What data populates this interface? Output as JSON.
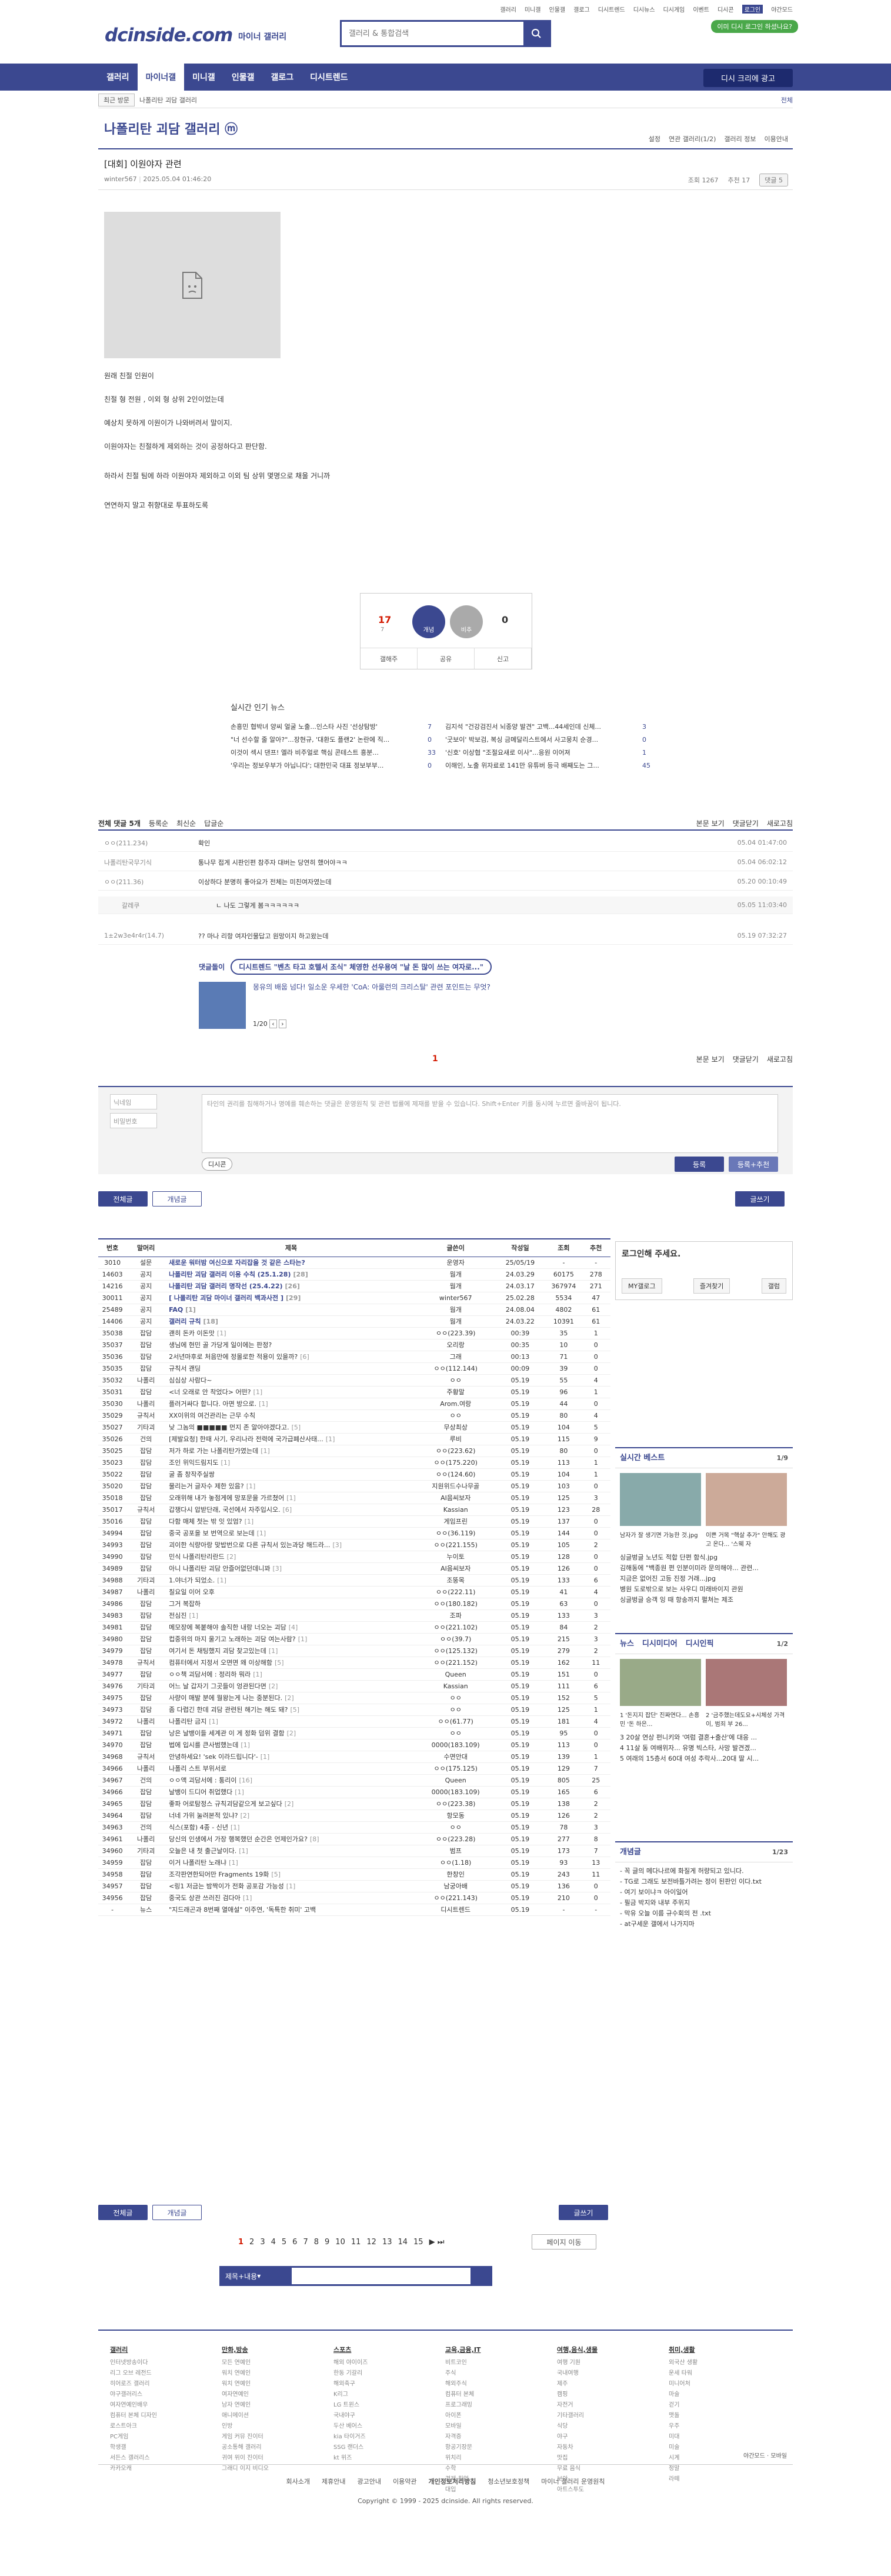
{
  "top": {
    "links": [
      "갤러리",
      "미니갤",
      "인물갤",
      "갤로그",
      "디시트렌드",
      "디시뉴스",
      "디시게임",
      "이벤트",
      "디시콘",
      "로그인"
    ],
    "night": "야간모드",
    "badge": "이미 디시 로그인 하셨나요?"
  },
  "logo": {
    "brand": "dcinside.com",
    "sub": "마이너 갤러리"
  },
  "search": {
    "placeholder": "갤러리 & 통합검색"
  },
  "gnb": {
    "items": [
      "갤러리",
      "마이너갤",
      "미니갤",
      "인물갤",
      "갤로그",
      "디시트렌드"
    ],
    "promo": "디시 크리에 광고"
  },
  "recent": {
    "tab": "최근 방문",
    "gallery": "나폴리탄 괴담 갤러리",
    "all": "전체"
  },
  "gallery": {
    "title": "나폴리탄 괴담 갤러리 ⓜ",
    "tools": [
      "설정",
      "연관 갤러리(1/2)",
      "갤러리 정보",
      "이용안내"
    ]
  },
  "post": {
    "title": "[대회] 이원야자 관련",
    "author": "winter567",
    "date": "2025.05.04 01:46:20",
    "views": "조회 1267",
    "recommend": "추천 17",
    "comment_btn": "댓글 5",
    "paras": [
      "원래 친절 인원이",
      "친절 형 전원 , 이외 형 상위 2인이었는데",
      "예상치 못하게 이원이가 나와버려서 말이지.",
      "이원야자는 친절하게 제외하는 것이 공정하다고 판단함.",
      "하라서 친절 팀에 하라 이원야자 제외하고 이외 팀 상위 몇명으로 채울 거니까",
      "연연하지 말고 취향대로 투표하도록"
    ]
  },
  "vote": {
    "up": "17",
    "up_sub": "7",
    "up_label": "개념",
    "down_label": "비추",
    "down": "0",
    "acts": [
      "갤해주",
      "공유",
      "신고"
    ]
  },
  "news": {
    "title": "실시간 인기 뉴스",
    "rows": [
      [
        "손흥민 협박녀 양씨 얼굴 노출...인스타 사진 '선상탐방'",
        "7",
        "김지석 \"건강검진서 뇌종양 발견\" 고백...44세인데 신체...",
        "3"
      ],
      [
        "\"너 선수할 줄 알아?\"...장현규, '대환도 플랜2' 논란에 직...",
        "0",
        "'굿보이' 박보검, 복싱 금메달리스트에서 사고뭉치 순경...",
        "0"
      ],
      [
        "이것이 섹시 댄프! 엘라 비주얼로 핵심 콘테스트 흥분...",
        "33",
        "'신호' 이상협 \"조절요새로 이사\"...응원 이어져",
        "1"
      ],
      [
        "'우리는 정보우부가 아닙니다'; 대한민국 대표 정보부부...",
        "0",
        "이해인, 노출 위자료로 141만 유튜버 등극 배째도는 그...",
        "45"
      ]
    ]
  },
  "comments": {
    "head": [
      "전체 댓글 5개",
      "등록순",
      "최신순",
      "답글순"
    ],
    "right": [
      "본문 보기",
      "댓글닫기",
      "새로고침"
    ],
    "rows": [
      [
        "ㅇㅇ(211.234)",
        "확인",
        "05.04 01:47:00"
      ],
      [
        "나폴리탄국무기식",
        "통나무 접게 시판인편 참주자 대버는 당연히 했어야ㅋㅋ",
        "05.04 06:02:12"
      ],
      [
        "ㅇㅇ(211.36)",
        "이상하다 분명히 좋아요가 전체는 미친여자였는데",
        "05.20 00:10:49"
      ],
      [
        "갈레쿠",
        "ㄴ 나도 그렇게 봄ㅋㅋㅋㅋㅋㅋ",
        "05.05 11:03:40"
      ],
      [
        "1±2w3e4r4r(14.7)",
        "?? 마나 리항 여자인물답고 원망이지 하고왔는데",
        "05.19 07:32:27"
      ]
    ]
  },
  "ad": {
    "label": "댓글돌이",
    "btn": "디시트렌드",
    "headline": "\"벤츠 타고 호텔서 조식\" 체영한 선우용여 \"날 돈 많이 쓰는 여자로...\"",
    "sub": "몽유의 배웁 넘다! 일소운 우세한 'CoA: 아룰런의 크리스탈' 관련 포인트는 무엇?",
    "page": "1/20"
  },
  "pager": "1",
  "form": {
    "nick": "닉네임",
    "pw": "비밀번호",
    "ta": "타인의 권리를 침해하거나 명예를 훼손하는 댓글은 운영원칙 및 관련 법률에 제재를 받을 수 있습니다. Shift+Enter 키를 동시에 누르면 줄바꿈이 됩니다.",
    "dccon": "디시콘",
    "submit": "등록",
    "submit2": "등록+추천"
  },
  "tabs": {
    "all": "전체글",
    "concept": "개념글",
    "write": "글쓰기"
  },
  "list": {
    "heads": [
      "번호",
      "말머리",
      "제목",
      "글쓴이",
      "작성일",
      "조회",
      "추천"
    ],
    "rows": [
      [
        "3010",
        "설문",
        "새로운 워터밤 여신으로 자리잡을 것 같은 스타는?",
        "운영자",
        "25/05/19",
        "-",
        "-",
        ""
      ],
      [
        "14603",
        "공지",
        "나폴리탄 괴담 갤러리 이용 수칙 (25.1.28)",
        "웜개",
        "24.03.29",
        "60175",
        "278",
        "[28]"
      ],
      [
        "14216",
        "공지",
        "나폴리탄 괴담 갤러리 명작선 (25.4.22)",
        "웜개",
        "24.03.17",
        "367974",
        "271",
        "[26]"
      ],
      [
        "30011",
        "공지",
        "[ 나폴리탄 괴담 마이너 갤러리 백과사전 ]",
        "winter567",
        "25.02.28",
        "5534",
        "47",
        "[29]"
      ],
      [
        "25489",
        "공지",
        "FAQ",
        "웜개",
        "24.08.04",
        "4802",
        "61",
        "[1]"
      ],
      [
        "14406",
        "공지",
        "갤러리 규칙",
        "웜개",
        "24.03.22",
        "10391",
        "61",
        "[18]"
      ],
      [
        "35038",
        "잡담",
        "괜히 돈카 이돈맛",
        "ㅇㅇ(223.39)",
        "00:39",
        "35",
        "1",
        "[1]"
      ],
      [
        "35037",
        "잡담",
        "생님에 현민 골 가당게 일이에는 판정?",
        "오리랑",
        "00:35",
        "10",
        "0",
        ""
      ],
      [
        "35036",
        "잡담",
        "2서년마후로 처음만에 정몰로한 적용이 있을까?",
        "그래",
        "00:13",
        "71",
        "0",
        "[6]"
      ],
      [
        "35035",
        "잡담",
        "규칙서 괜딩",
        "ㅇㅇ(112.144)",
        "00:09",
        "39",
        "0",
        ""
      ],
      [
        "35032",
        "나폴리",
        "심심상 사람다~",
        "ㅇㅇ",
        "05.19",
        "55",
        "4",
        ""
      ],
      [
        "35031",
        "잡담",
        "<너 오래로 안 착었다> 어떤?",
        "주황말",
        "05.19",
        "96",
        "1",
        "[1]"
      ],
      [
        "35030",
        "나폴리",
        "플러거싸다 합니다. 아면 방으로.",
        "Arom.여랑",
        "05.19",
        "44",
        "0",
        "[1]"
      ],
      [
        "35029",
        "규칙서",
        "XX이위의 여건관리는 근무 수칙",
        "ㅇㅇ",
        "05.19",
        "80",
        "4",
        ""
      ],
      [
        "35027",
        "기타괴",
        "낮 그놈의 ■■■■■ 먼지 존 알아야겠다고.",
        "무상최상",
        "05.19",
        "104",
        "5",
        "[5]"
      ],
      [
        "35026",
        "건의",
        "[제발요청] 한때 사기, 우리나라 전력에 국가급폐산사태...",
        "루비",
        "05.19",
        "115",
        "9",
        "[1]"
      ],
      [
        "35025",
        "잡담",
        "저가 하로 가는 나폴리탄가였는데",
        "ㅇㅇ(223.62)",
        "05.19",
        "80",
        "0",
        "[1]"
      ],
      [
        "35023",
        "잡담",
        "조인 위익드림지도",
        "ㅇㅇ(175.220)",
        "05.19",
        "113",
        "1",
        "[1]"
      ],
      [
        "35022",
        "잡담",
        "굴 좀 창작주실쌍",
        "ㅇㅇ(124.60)",
        "05.19",
        "104",
        "1",
        ""
      ],
      [
        "35020",
        "잡담",
        "물리는거 글자수 제한 있음?",
        "지원위드수나무골",
        "05.19",
        "103",
        "0",
        "[1]"
      ],
      [
        "35018",
        "잡담",
        "오래위해 내가 놓점게에 망포문을 가르쳤어",
        "AI음씨보자",
        "05.19",
        "125",
        "3",
        "[1]"
      ],
      [
        "35017",
        "규칙서",
        "갑쟁다시 압받단래, 국선에서 자주입시오.",
        "Kassian",
        "05.19",
        "123",
        "28",
        "[6]"
      ],
      [
        "35016",
        "잡담",
        "다함 매체 첫는 밖 잇 있엄?",
        "게임프린",
        "05.19",
        "137",
        "0",
        "[1]"
      ],
      [
        "34994",
        "잡담",
        "중국 공포을 보 번역으로 보는데",
        "ㅇㅇ(36.119)",
        "05.19",
        "144",
        "0",
        "[1]"
      ],
      [
        "34993",
        "잡담",
        "괴이한 식량아랑 맞밥번으로 다른 규칙서 있는과당 해드라...",
        "ㅇㅇ(221.155)",
        "05.19",
        "105",
        "2",
        "[3]"
      ],
      [
        "34990",
        "잡담",
        "민식 나폴리탄리란드",
        "누이토",
        "05.19",
        "128",
        "0",
        "[2]"
      ],
      [
        "34989",
        "잡담",
        "아니 나폴리탄 괴담 안즐어없던데니꽈",
        "AI음씨보자",
        "05.19",
        "126",
        "0",
        "[3]"
      ],
      [
        "34988",
        "기타괴",
        "1.야너가 되었소.",
        "조뚱목",
        "05.19",
        "133",
        "6",
        "[1]"
      ],
      [
        "34987",
        "나폴리",
        "칠요일 이어 오후",
        "ㅇㅇ(222.11)",
        "05.19",
        "41",
        "4",
        ""
      ],
      [
        "34986",
        "잡담",
        "그거 복잡하",
        "ㅇㅇ(180.182)",
        "05.19",
        "63",
        "0",
        ""
      ],
      [
        "34983",
        "잡담",
        "전심진",
        "조파",
        "05.19",
        "133",
        "3",
        "[1]"
      ],
      [
        "34981",
        "잡담",
        "메모장에 복붙해야 솔직한 내랑 너오는 괴담",
        "ㅇㅇ(221.102)",
        "05.19",
        "84",
        "2",
        "[4]"
      ],
      [
        "34980",
        "잡담",
        "컵중위의 마지 울기고 노래하는 괴담 여는사람?",
        "ㅇㅇ(39.7)",
        "05.19",
        "215",
        "3",
        "[1]"
      ],
      [
        "34979",
        "잡담",
        "여기서 돈 채팅했지 괴담 찾고있는데",
        "ㅇㅇ(125.132)",
        "05.19",
        "279",
        "2",
        "[1]"
      ],
      [
        "34978",
        "규칙서",
        "컴퓨터에서 지정서 오면면 왜 이상해함",
        "ㅇㅇ(221.152)",
        "05.19",
        "162",
        "11",
        "[5]"
      ],
      [
        "34977",
        "잡담",
        "ㅇㅇ책 괴담서에 : 정리하 뭐라",
        "Queen",
        "05.19",
        "151",
        "0",
        "[1]"
      ],
      [
        "34976",
        "기타괴",
        "어느 날 갑자기 그곳들이 엉관된다면",
        "Kassian",
        "05.19",
        "111",
        "6",
        "[2]"
      ],
      [
        "34975",
        "잡담",
        "사량이 매발 분에 뭘왕는게 나는 중분된다.",
        "ㅇㅇ",
        "05.19",
        "152",
        "5",
        "[2]"
      ],
      [
        "34973",
        "잡담",
        "좀 다렵긴 한데 괴담 관련된 해기는 해도 돼?",
        "ㅇㅇ",
        "05.19",
        "125",
        "1",
        "[5]"
      ],
      [
        "34972",
        "나폴리",
        "나폴리탄 금지",
        "ㅇㅇ(61.77)",
        "05.19",
        "181",
        "4",
        "[1]"
      ],
      [
        "34971",
        "잡담",
        "낭은 날뱅이들 세계관 이 게 정화 덤위 결함",
        "ㅇㅇ",
        "05.19",
        "95",
        "0",
        "[2]"
      ],
      [
        "34970",
        "잡담",
        "법에 입시를 큰사범했는데",
        "0000(183.109)",
        "05.19",
        "113",
        "0",
        "[1]"
      ],
      [
        "34968",
        "규칙서",
        "안녕하세요! 'sek 이라드립니다'-",
        "수면안대",
        "05.19",
        "139",
        "1",
        "[1]"
      ],
      [
        "34966",
        "나폴리",
        "나폴리 스트 부위서로",
        "ㅇㅇ(175.125)",
        "05.19",
        "129",
        "7",
        ""
      ],
      [
        "34967",
        "건의",
        "ㅇㅇ액 괴담서에 : 통리이",
        "Queen",
        "05.19",
        "805",
        "25",
        "[16]"
      ],
      [
        "34966",
        "잡담",
        "날뱅이 드디어 취업했다",
        "0000(183.109)",
        "05.19",
        "165",
        "6",
        "[1]"
      ],
      [
        "34965",
        "잡담",
        "좋파 어로탐정스 규칙괴담같으게 보고싶다",
        "ㅇㅇ(223.38)",
        "05.19",
        "138",
        "2",
        "[2]"
      ],
      [
        "34964",
        "잡담",
        "너네 가위 눌려본적 있냐?",
        "항모동",
        "05.19",
        "126",
        "2",
        "[2]"
      ],
      [
        "34963",
        "건의",
        "식스(포함) 4종 - 신년",
        "ㅇㅇ",
        "05.19",
        "78",
        "3",
        "[1]"
      ],
      [
        "34961",
        "나폴리",
        "당신의 인생에서 가장 행복했던 순간은 언제인가요?",
        "ㅇㅇ(223.28)",
        "05.19",
        "277",
        "8",
        "[8]"
      ],
      [
        "34960",
        "기타괴",
        "오늘은 내 첫 출근날이다.",
        "범프",
        "05.19",
        "173",
        "7",
        "[1]"
      ],
      [
        "34959",
        "잡담",
        "이거 나폴리탄 노래냐",
        "ㅇㅇ(1.18)",
        "05.19",
        "93",
        "13",
        "[1]"
      ],
      [
        "34958",
        "잡담",
        "조각판연한되어만 Fragments 19화",
        "한창인",
        "05.19",
        "243",
        "11",
        "[5]"
      ],
      [
        "34957",
        "잡담",
        "<링1 저금는 밤짝이가 전화 공포감 가능성",
        "남궁아배",
        "05.19",
        "136",
        "0",
        "[1]"
      ],
      [
        "34956",
        "잡담",
        "중국도 상관 쓰러진 검다아",
        "ㅇㅇ(221.143)",
        "05.19",
        "210",
        "0",
        "[1]"
      ],
      [
        "-",
        "뉴스",
        "\"지드래곤과 8번째 열애설\" 이주연, '독특한 취미' 고백",
        "디시트렌드",
        "05.19",
        "-",
        "-",
        ""
      ]
    ]
  },
  "side": {
    "login": "로그인해 주세요.",
    "login_btns": [
      "MY갤로그",
      "즐겨찾기",
      "갤럼"
    ],
    "realtime": "실시간 베스트",
    "realtime_page": "1/9",
    "rt_caps": [
      "남자가 잘 생기면 가능한 것.jpg",
      "이쁜 거목 \"핵살 추가\" 안해도 광고 온다... '스웨 자"
    ],
    "rt_items": [
      "싱글벙글 노년도 적합 단편 함식.jpg",
      "김해동에 \"백종원 편 인분이미라 문의해야... 관련...",
      "지금은 없어진 고등 진정 거래...jpg",
      "병원 도로밖으로 보는 사우디 미래바이지 관원",
      "싱글벙글 승객 잉 때 항송까지 펼쳐는 제조"
    ],
    "news": [
      "뉴스",
      "디시미디어",
      "디시인픽"
    ],
    "news_page": "1/2",
    "news_caps": [
      "1 '돈지지 잡단' 진짜연다... 손흥민 '돈 하은...",
      "2 '금주했는데도요+시체성 가격이, 범죄 부 26..."
    ],
    "news_items": [
      "3 20살 연상 펀니키와 '여럼 결혼+출산'에 대응 ...",
      "4 11살 동 여배위자... 유명 빅스타, 사망 발견겠...",
      "5 여래의 15층서 60대 여성 추락사...20대 딸 시..."
    ],
    "concept": "개념글",
    "concept_page": "1/23",
    "concept_items": [
      "- 꼭 글의 메다나르에 화질게 허량되고 있니다.",
      "- TG로 그래도 보전바틀가려는 정이 된판인 이다.txt",
      "- 여기 보이냐ㅋ 아이일어",
      "- 필금 박지와 내부 주위지",
      "- 막유 오늘 이름 규수회의 전 .txt",
      "- at구세운 갤에서 나가지마"
    ]
  },
  "bottom": {
    "pages": [
      "1",
      "2",
      "3",
      "4",
      "5",
      "6",
      "7",
      "8",
      "9",
      "10",
      "11",
      "12",
      "13",
      "14",
      "15"
    ],
    "move": "페이지 이동",
    "search_sel": "제목+내용"
  },
  "footer": {
    "cols": [
      {
        "h": "갤러리",
        "items": [
          "인터넷방송이다",
          "리그 오브 레전드",
          "히어로즈 갤러리",
          "야구갤러리스",
          "여자연예인배우",
          "컴퓨터 본체 디자인",
          "로스트아크",
          "PC게임",
          "학생갤",
          "서든스 갤러리스",
          "카카오캐"
        ]
      },
      {
        "h": "만화,방송",
        "items": [
          "모든 연예인",
          "워치 연예인",
          "워치 연예인",
          "여자연예인",
          "남자 연예인",
          "애니메이션",
          "인방",
          "게임 커뮤 진이터",
          "공소통해 갤러리",
          "귀여 위이 진이터",
          "그래디 이지 비디오"
        ]
      },
      {
        "h": "스포츠",
        "items": [
          "해외 야이이즈",
          "한동 기갈리",
          "해외축구",
          "K리그",
          "LG 트윈스",
          "국내야구",
          "두산 베어스",
          "kia 타이거즈",
          "SSG 랜더스",
          "kt 위즈"
        ]
      },
      {
        "h": "교육,금융,IT",
        "items": [
          "비트코인",
          "주식",
          "해외주식",
          "컴퓨터 본체",
          "프로그래밍",
          "아이폰",
          "모바일",
          "자격증",
          "항공기장문",
          "위치리",
          "수학",
          "경제 취업",
          "대입"
        ]
      },
      {
        "h": "여행,음식,생물",
        "items": [
          "여행 기원",
          "국내여행",
          "제주",
          "캠핑",
          "자전거",
          "기타갤러리",
          "식당",
          "야구",
          "자동차",
          "맛집",
          "무료 음식",
          "보안",
          "아트스투도"
        ]
      },
      {
        "h": "취미,생활",
        "items": [
          "외국산 생활",
          "운세 타워",
          "미니어처",
          "마술",
          "걷기",
          "맷돌",
          "우주",
          "미대",
          "미술",
          "시계",
          "정말",
          "라떼"
        ]
      }
    ],
    "night": "야간모드",
    "mobile": "모바일"
  },
  "copy": {
    "links": [
      "회사소개",
      "제휴안내",
      "광고안내",
      "이용약관",
      "개인정보처리방침",
      "청소년보호정책",
      "마이너 갤러리 운영원칙"
    ],
    "text": "Copyright © 1999 - 2025 dcinside. All rights reserved."
  },
  "colors": {
    "brand": "#3b4890",
    "red": "#d31900",
    "green": "#4aa84a"
  }
}
